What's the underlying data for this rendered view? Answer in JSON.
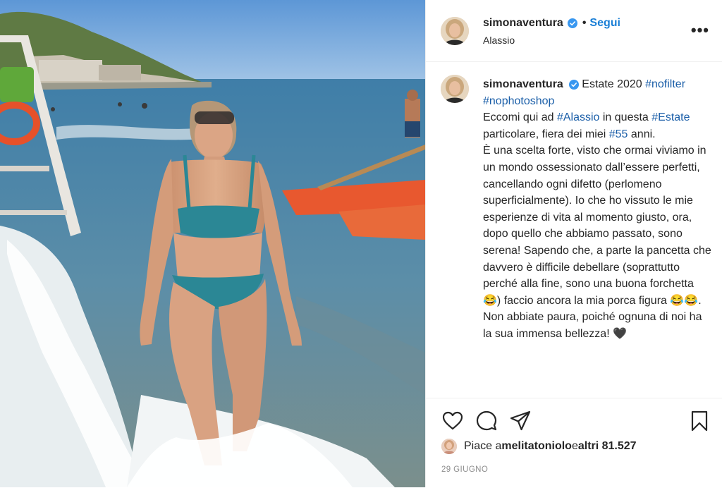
{
  "post": {
    "username": "simonaventura",
    "follow_label": "Segui",
    "separator": "•",
    "location": "Alassio",
    "more_label": "•••",
    "caption": {
      "username": "simonaventura",
      "title": "Estate 2020 ",
      "tag_nofilter": "#nofilter",
      "tag_nophotoshop": "#nophotoshop",
      "line1_pre": "Eccomi qui ad ",
      "tag_alassio": "#Alassio",
      "line1_post": " in questa",
      "tag_estate": "#Estate",
      "line2_mid": " particolare, fiera dei miei ",
      "tag_55": "#55",
      "line2_post": " anni.",
      "body": "È una scelta forte, visto che ormai viviamo in un mondo ossessionato dall’essere perfetti, cancellando ogni difetto (perlomeno superficialmente). Io che ho vissuto le mie esperienze di vita al momento giusto, ora, dopo quello che abbiamo passato, sono serena! Sapendo che, a parte la pancetta che davvero è difficile debellare (soprattutto perché alla fine, sono una buona forchetta 😂) faccio ancora la mia porca figura 😂😂. Non abbiate paura, poiché ognuna di noi ha la sua immensa bellezza! 🖤"
    },
    "likes": {
      "prefix": "Piace a ",
      "user": "melitatoniolo",
      "middle": " e ",
      "others": "altri 81.527"
    },
    "date": "29 GIUGNO",
    "colors": {
      "link": "#1a7fd6",
      "hashtag": "#1a5ea8",
      "verified": "#3897f0",
      "muted": "#8e8e8e"
    },
    "icons": [
      "heart-icon",
      "comment-icon",
      "share-icon",
      "bookmark-icon",
      "verified-badge-icon"
    ]
  }
}
